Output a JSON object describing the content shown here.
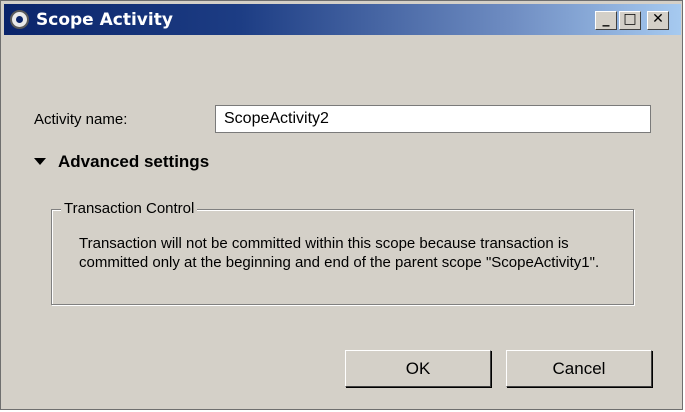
{
  "window": {
    "title": "Scope Activity",
    "controls": {
      "minimize": "_",
      "maximize": "□",
      "close": "✕"
    }
  },
  "form": {
    "activity_name_label": "Activity name:",
    "activity_name_value": "ScopeActivity2"
  },
  "advanced": {
    "label": "Advanced settings",
    "expanded": true,
    "group_title": "Transaction Control",
    "message": "Transaction will not be committed within this scope because transaction is committed only at the beginning and end of the parent scope \"ScopeActivity1\"."
  },
  "buttons": {
    "ok": "OK",
    "cancel": "Cancel"
  },
  "icons": {
    "app": "settings-gear-icon",
    "caret": "caret-down-icon"
  },
  "colors": {
    "titlebar_start": "#0a246a",
    "titlebar_end": "#a6caf0",
    "dialog_bg": "#d4d0c8"
  }
}
